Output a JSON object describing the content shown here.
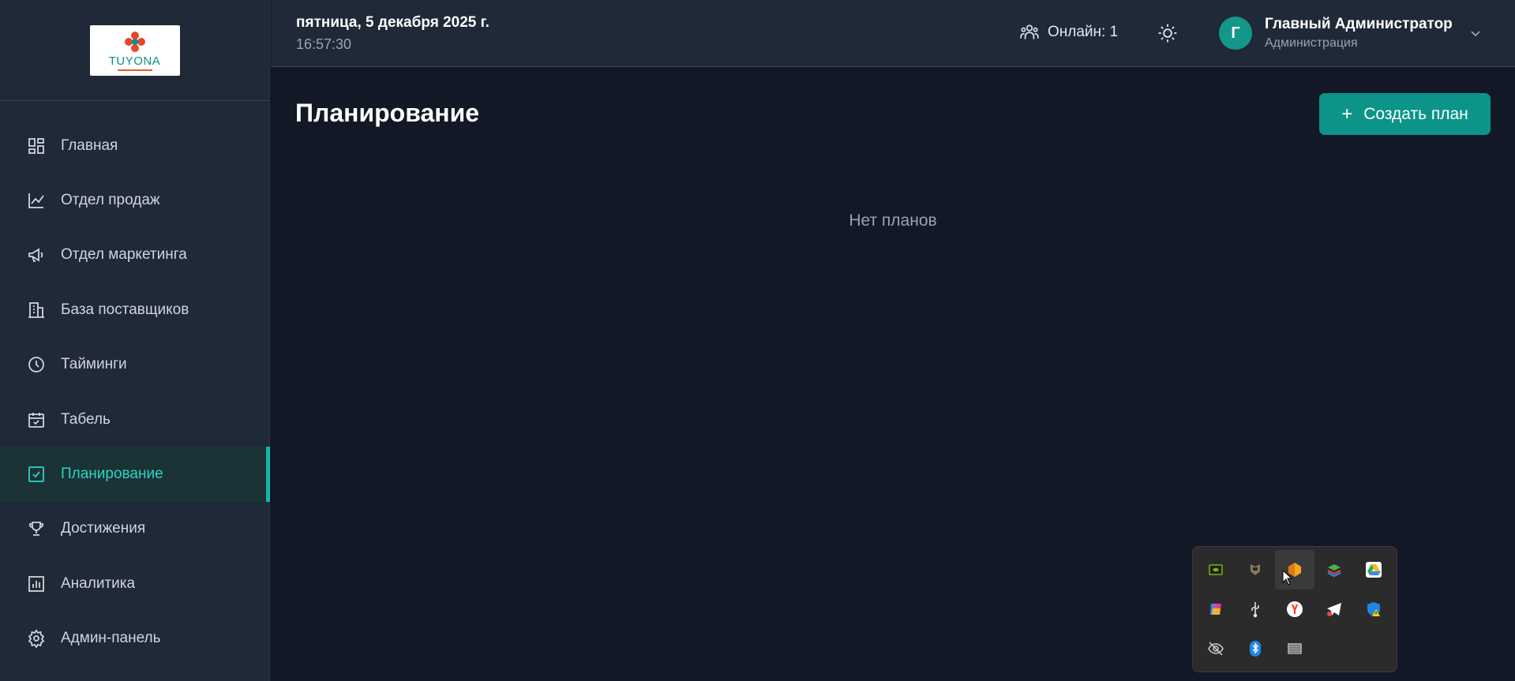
{
  "header": {
    "date": "пятница, 5 декабря 2025 г.",
    "time": "16:57:30",
    "online": "Онлайн: 1",
    "user_initial": "Г",
    "user_name": "Главный Администратор",
    "user_role": "Администрация"
  },
  "logo": {
    "text": "TUYONA"
  },
  "sidebar": {
    "items": [
      {
        "label": "Главная",
        "icon": "dashboard-icon"
      },
      {
        "label": "Отдел продаж",
        "icon": "chart-line-icon"
      },
      {
        "label": "Отдел маркетинга",
        "icon": "megaphone-icon"
      },
      {
        "label": "База поставщиков",
        "icon": "building-icon"
      },
      {
        "label": "Тайминги",
        "icon": "clock-icon"
      },
      {
        "label": "Табель",
        "icon": "calendar-check-icon"
      },
      {
        "label": "Планирование",
        "icon": "checkbox-icon",
        "active": true
      },
      {
        "label": "Достижения",
        "icon": "trophy-icon"
      },
      {
        "label": "Аналитика",
        "icon": "bar-chart-icon"
      },
      {
        "label": "Админ-панель",
        "icon": "gear-icon"
      }
    ]
  },
  "main": {
    "title": "Планирование",
    "create_button": "Создать план",
    "empty_text": "Нет планов"
  },
  "tray": {
    "icons": [
      "nvidia-icon",
      "game-icon",
      "app-orange-icon",
      "bluestacks-icon",
      "google-drive-icon",
      "copilot-icon",
      "usb-icon",
      "yandex-icon",
      "telegram-icon",
      "defender-warning-icon",
      "hidden-eye-icon",
      "bluetooth-icon",
      "keyboard-icon"
    ]
  },
  "colors": {
    "accent": "#0d9488",
    "accent_text": "#2dd4bf",
    "sidebar_bg": "#1f2937",
    "main_bg": "#121826"
  }
}
